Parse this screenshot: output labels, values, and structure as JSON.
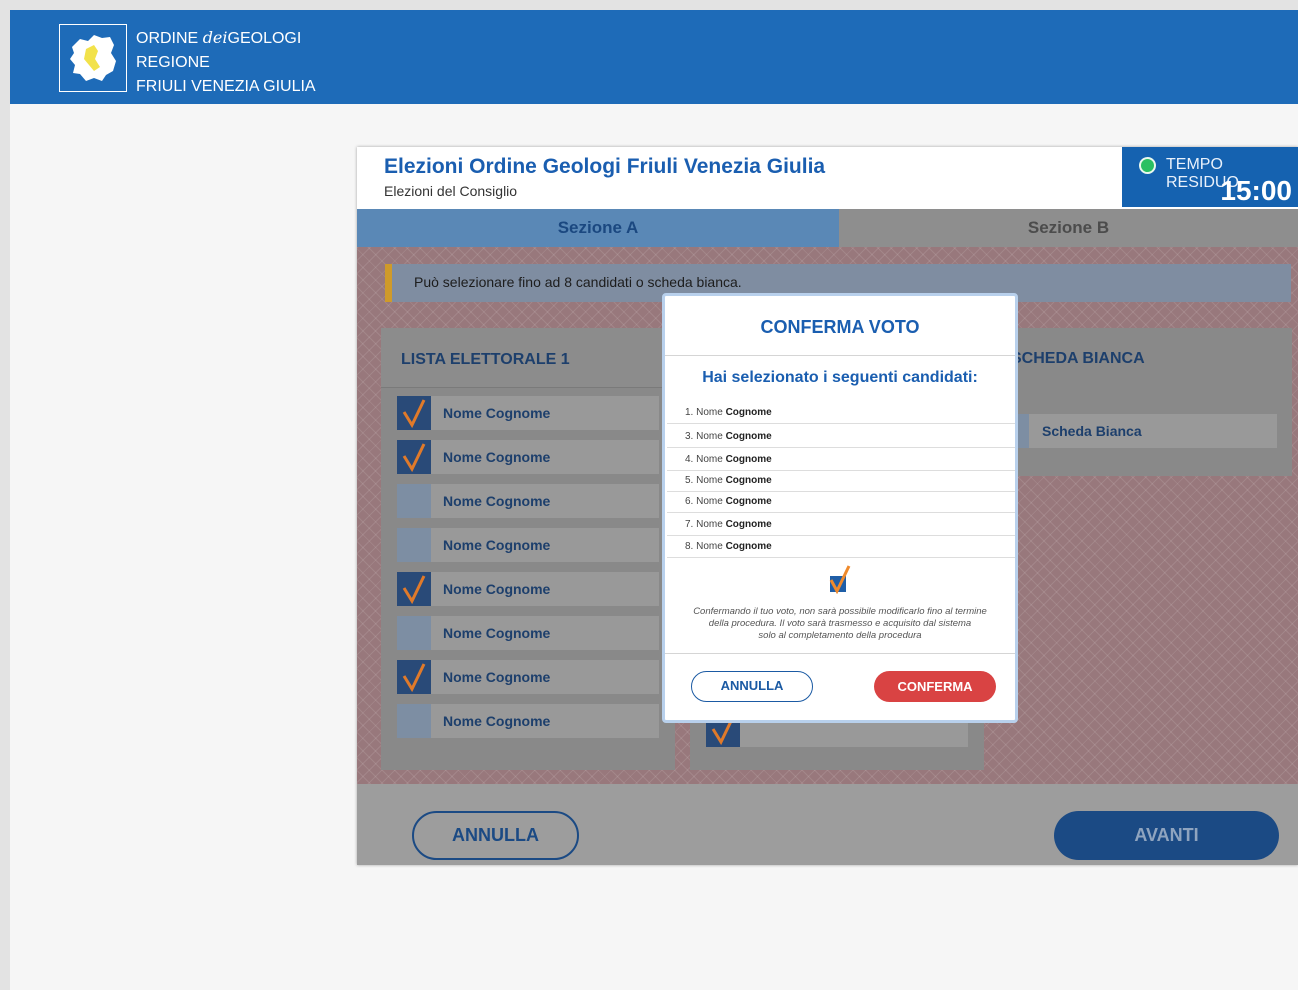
{
  "header": {
    "org_line1_a": "ORDINE",
    "org_line1_b": "dei",
    "org_line1_c": "GEOLOGI",
    "org_line2": "REGIONE",
    "org_line3": "FRIULI VENEZIA GIULIA",
    "bar_color": "#1e6bb8"
  },
  "election": {
    "title": "Elezioni Ordine Geologi Friuli Venezia Giulia",
    "subtitle": "Elezioni del Consiglio",
    "timer_label": "TEMPO RESIDUO",
    "timer_value": "15:00"
  },
  "tabs": [
    {
      "label": "Sezione A",
      "active": true
    },
    {
      "label": "Sezione B",
      "active": false
    }
  ],
  "notice": "Può selezionare fino ad 8 candidati o scheda bianca.",
  "list1": {
    "title": "LISTA ELETTORALE 1",
    "candidates": [
      {
        "name": "Nome Cognome",
        "checked": true
      },
      {
        "name": "Nome Cognome",
        "checked": true
      },
      {
        "name": "Nome Cognome",
        "checked": false
      },
      {
        "name": "Nome Cognome",
        "checked": false
      },
      {
        "name": "Nome Cognome",
        "checked": true
      },
      {
        "name": "Nome Cognome",
        "checked": false
      },
      {
        "name": "Nome Cognome",
        "checked": true
      },
      {
        "name": "Nome Cognome",
        "checked": false
      }
    ]
  },
  "blank_ballot": {
    "title": "SCHEDA BIANCA",
    "label": "Scheda Bianca"
  },
  "footer": {
    "cancel_label": "ANNULLA",
    "next_label": "AVANTI"
  },
  "modal": {
    "title": "CONFERMA VOTO",
    "subtitle": "Hai selezionato i seguenti candidati:",
    "selected": [
      {
        "prefix": "1. Nome",
        "surname": "Cognome"
      },
      {
        "prefix": "3. Nome",
        "surname": "Cognome"
      },
      {
        "prefix": "4. Nome",
        "surname": "Cognome"
      },
      {
        "prefix": "5. Nome",
        "surname": "Cognome"
      },
      {
        "prefix": "6. Nome",
        "surname": "Cognome"
      },
      {
        "prefix": "7. Nome",
        "surname": "Cognome"
      },
      {
        "prefix": "8. Nome",
        "surname": "Cognome"
      }
    ],
    "note_line1": "Confermando il tuo voto, non sarà possibile modificarlo fino al termine",
    "note_line2": "della procedura. Il voto sarà trasmesso e acquisito dal sistema",
    "note_line3": "solo al completamento della procedura",
    "cancel_label": "ANNULLA",
    "confirm_label": "CONFERMA",
    "confirm_color": "#d94343"
  }
}
